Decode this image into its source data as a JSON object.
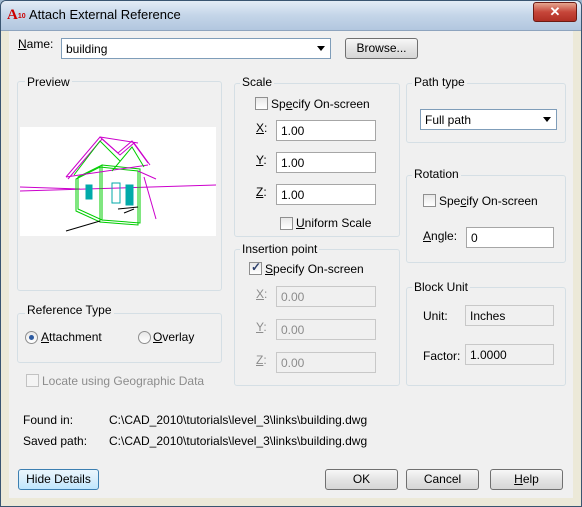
{
  "window": {
    "title": "Attach External Reference",
    "app_icon_text": "A",
    "app_icon_sub": "10",
    "close_glyph": "✕"
  },
  "name_row": {
    "label": "Name:",
    "value": "building",
    "browse_label": "Browse..."
  },
  "preview": {
    "title": "Preview"
  },
  "scale": {
    "title": "Scale",
    "specify_on_screen": {
      "label": "Specify On-screen",
      "checked": false
    },
    "x": {
      "label": "X:",
      "value": "1.00"
    },
    "y": {
      "label": "Y:",
      "value": "1.00"
    },
    "z": {
      "label": "Z:",
      "value": "1.00"
    },
    "uniform_scale": {
      "label": "Uniform Scale",
      "checked": false
    }
  },
  "path_type": {
    "title": "Path type",
    "selected": "Full path"
  },
  "rotation": {
    "title": "Rotation",
    "specify_on_screen": {
      "label": "Specify On-screen",
      "checked": false
    },
    "angle_label": "Angle:",
    "angle_value": "0"
  },
  "insertion_point": {
    "title": "Insertion point",
    "specify_on_screen": {
      "label": "Specify On-screen",
      "checked": true
    },
    "x": {
      "label": "X:",
      "value": "0.00"
    },
    "y": {
      "label": "Y:",
      "value": "0.00"
    },
    "z": {
      "label": "Z:",
      "value": "0.00"
    }
  },
  "reference_type": {
    "title": "Reference Type",
    "attachment_label": "Attachment",
    "overlay_label": "Overlay",
    "selected": "Attachment"
  },
  "block_unit": {
    "title": "Block Unit",
    "unit_label": "Unit:",
    "unit_value": "Inches",
    "factor_label": "Factor:",
    "factor_value": "1.0000"
  },
  "geo": {
    "label": "Locate using Geographic Data",
    "checked": false
  },
  "paths": {
    "found_in_label": "Found in:",
    "found_in_value": "C:\\CAD_2010\\tutorials\\level_3\\links\\building.dwg",
    "saved_path_label": "Saved path:",
    "saved_path_value": "C:\\CAD_2010\\tutorials\\level_3\\links\\building.dwg"
  },
  "buttons": {
    "hide_details": "Hide Details",
    "ok": "OK",
    "cancel": "Cancel",
    "help": "Help"
  },
  "colors": {
    "preview_magenta": "#cc00cc",
    "preview_green": "#00cc00",
    "preview_teal": "#00aaaa"
  }
}
